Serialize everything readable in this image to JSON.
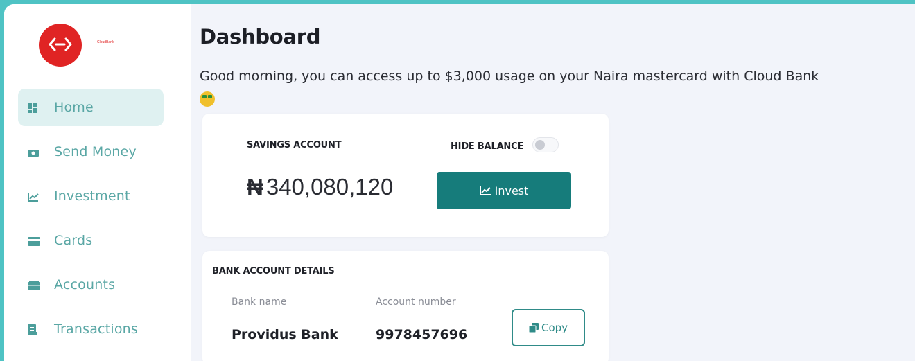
{
  "brand": {
    "name": "CloudBank",
    "accent": "#167c7b",
    "logo_color": "#e02424"
  },
  "sidebar": {
    "items": [
      {
        "label": "Home",
        "icon": "dashboard-icon",
        "active": true
      },
      {
        "label": "Send Money",
        "icon": "money-icon",
        "active": false
      },
      {
        "label": "Investment",
        "icon": "chart-icon",
        "active": false
      },
      {
        "label": "Cards",
        "icon": "card-icon",
        "active": false
      },
      {
        "label": "Accounts",
        "icon": "wallet-icon",
        "active": false
      },
      {
        "label": "Transactions",
        "icon": "receipt-icon",
        "active": false
      }
    ]
  },
  "main": {
    "title": "Dashboard",
    "greeting": "Good morning, you can access up to $3,000 usage on your Naira mastercard with Cloud Bank",
    "greeting_emoji": "money-face-emoji-icon"
  },
  "savings": {
    "label": "SAVINGS ACCOUNT",
    "hide_balance_label": "HIDE BALANCE",
    "hide_balance_on": false,
    "currency_symbol": "₦",
    "balance": "340,080,120",
    "invest_label": "Invest"
  },
  "bank_details": {
    "label": "BANK ACCOUNT DETAILS",
    "bank_name_label": "Bank name",
    "bank_name": "Providus Bank",
    "account_number_label": "Account number",
    "account_number": "9978457696",
    "copy_label": "Copy"
  }
}
